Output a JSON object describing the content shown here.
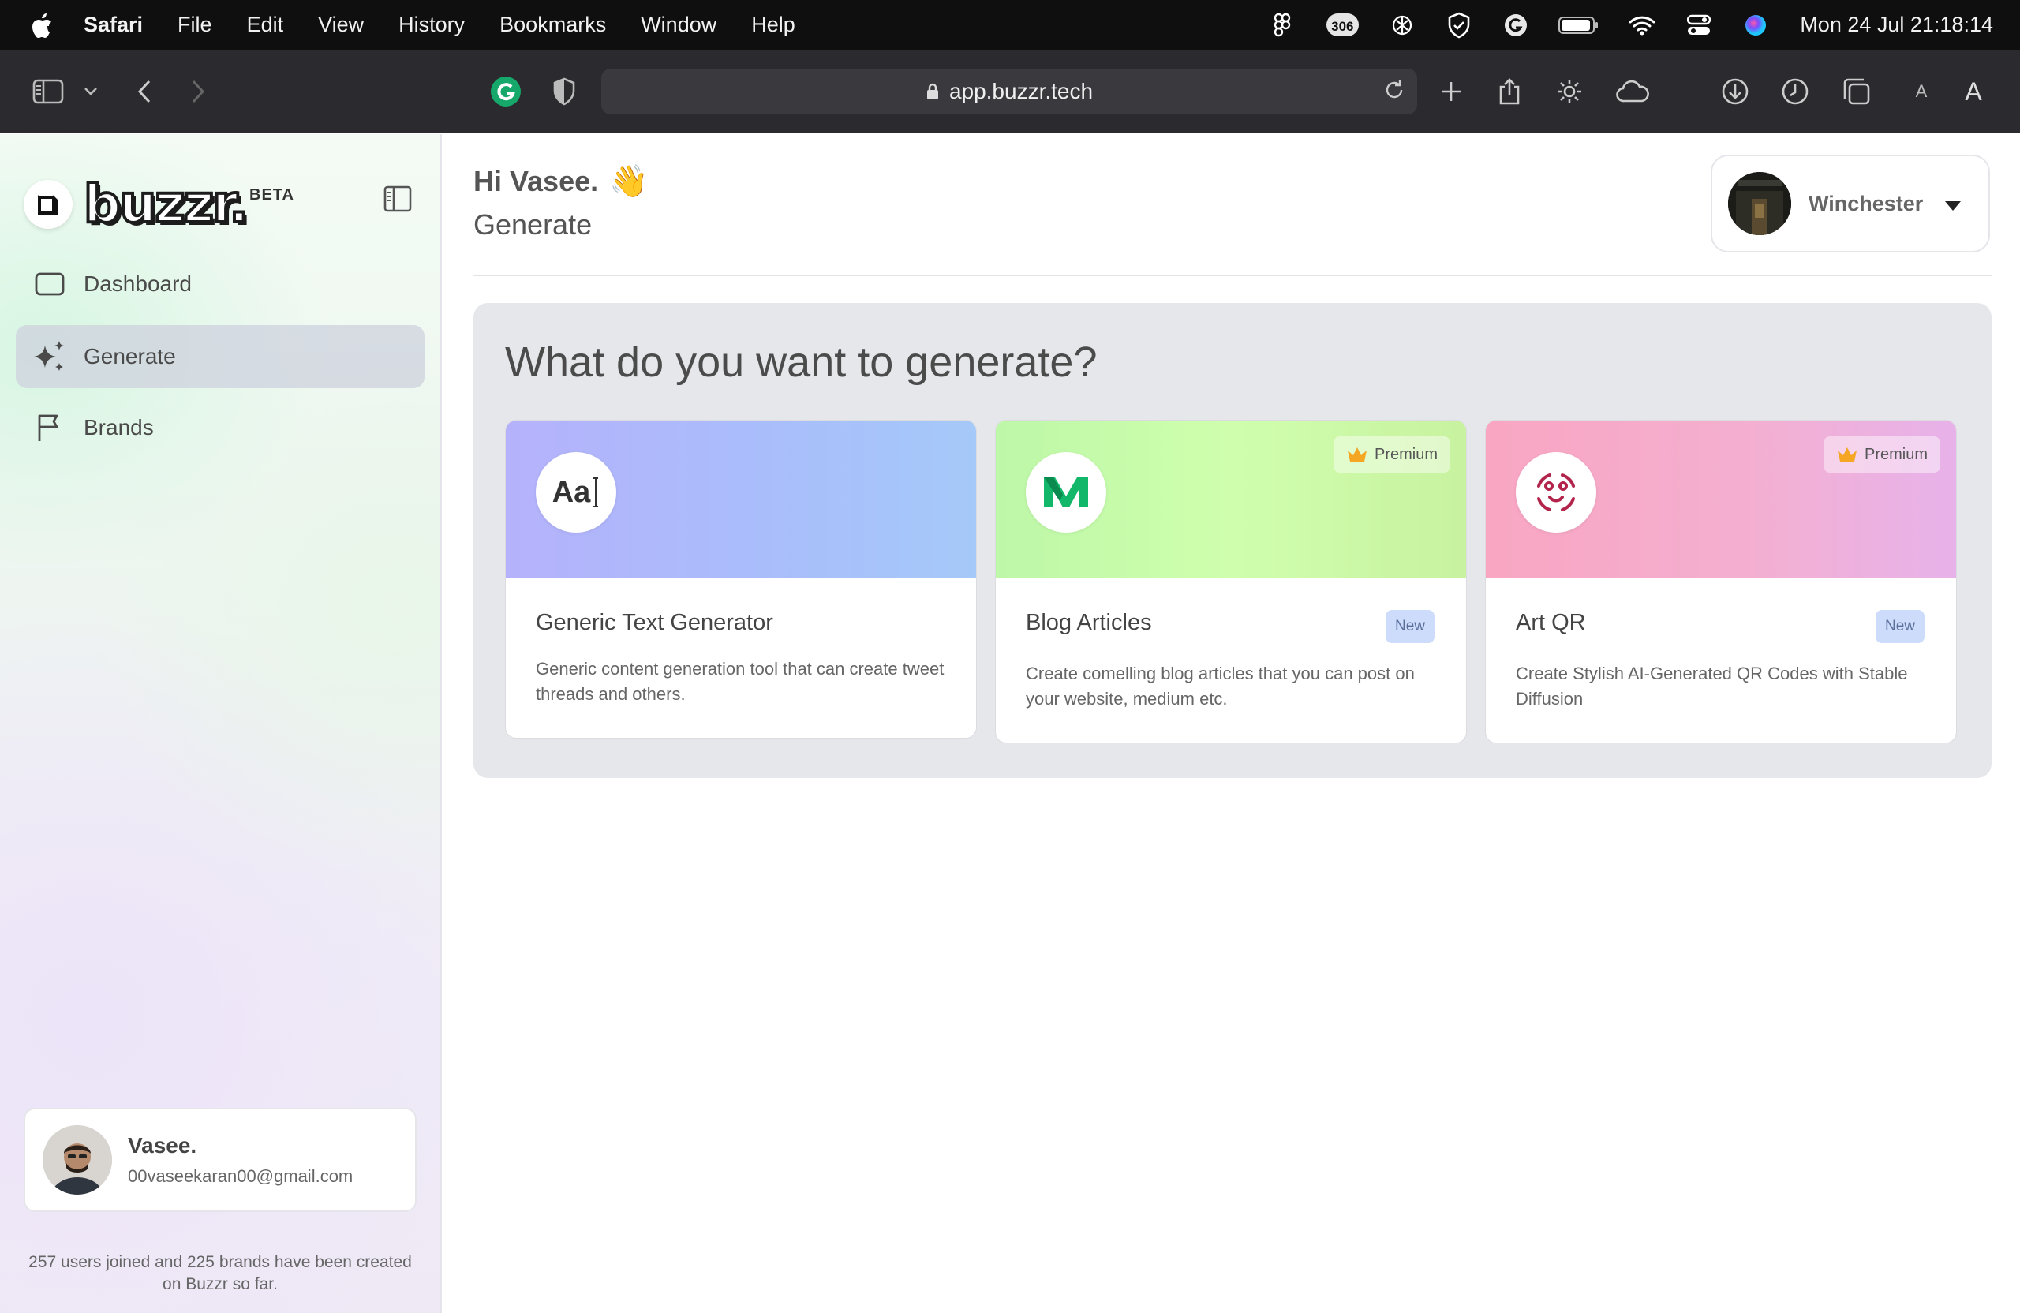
{
  "menubar": {
    "app_name": "Safari",
    "items": [
      "File",
      "Edit",
      "View",
      "History",
      "Bookmarks",
      "Window",
      "Help"
    ],
    "badge_count": "306",
    "clock": "Mon 24 Jul  21:18:14"
  },
  "browser": {
    "url": "app.buzzr.tech",
    "text_size_small": "A",
    "text_size_large": "A"
  },
  "sidebar": {
    "logo_text": "buzzr.",
    "beta_label": "BETA",
    "nav": [
      {
        "label": "Dashboard",
        "icon": "square-icon"
      },
      {
        "label": "Generate",
        "icon": "sparkles-icon",
        "active": true
      },
      {
        "label": "Brands",
        "icon": "flag-icon"
      }
    ],
    "user": {
      "name": "Vasee.",
      "email": "00vaseekaran00@gmail.com"
    },
    "footer_note": "257 users joined and 225 brands have been created on Buzzr so far."
  },
  "main": {
    "greeting": "Hi Vasee.",
    "greeting_emoji": "👋",
    "page_title": "Generate",
    "brand_selector": {
      "name": "Winchester"
    },
    "panel_title": "What do you want to generate?",
    "cards": [
      {
        "title": "Generic Text Generator",
        "description": "Generic content generation tool that can create tweet threads and others.",
        "icon_text": "Aa",
        "premium": false,
        "badge": ""
      },
      {
        "title": "Blog Articles",
        "description": "Create comelling blog articles that you can post on your website, medium etc.",
        "premium_label": "Premium",
        "badge": "New"
      },
      {
        "title": "Art QR",
        "description": "Create Stylish AI-Generated QR Codes with Stable Diffusion",
        "premium_label": "Premium",
        "badge": "New"
      }
    ]
  },
  "colors": {
    "accent_active_nav": "#cdd2de",
    "new_badge_bg": "#cddcfb",
    "premium_crown": "#f5a623",
    "medium_logo": "#12b76a",
    "artqr_icon": "#b3244b"
  }
}
